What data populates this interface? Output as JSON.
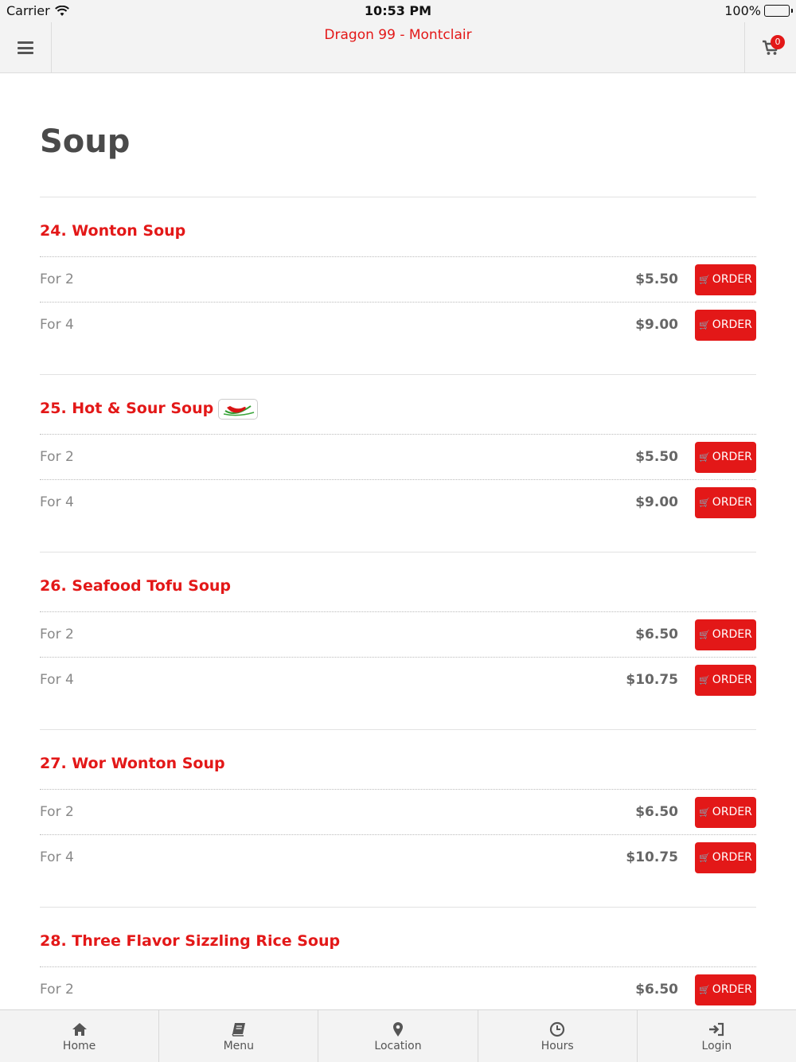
{
  "status_bar": {
    "carrier": "Carrier",
    "time": "10:53 PM",
    "battery": "100%"
  },
  "navbar": {
    "title": "Dragon 99 - Montclair",
    "cart_count": "0"
  },
  "page": {
    "title": "Soup"
  },
  "order_label": "ORDER",
  "items": [
    {
      "title": "24. Wonton Soup",
      "spicy": false,
      "options": [
        {
          "label": "For 2",
          "price": "$5.50"
        },
        {
          "label": "For 4",
          "price": "$9.00"
        }
      ]
    },
    {
      "title": "25. Hot & Sour Soup",
      "spicy": true,
      "options": [
        {
          "label": "For 2",
          "price": "$5.50"
        },
        {
          "label": "For 4",
          "price": "$9.00"
        }
      ]
    },
    {
      "title": "26. Seafood Tofu Soup",
      "spicy": false,
      "options": [
        {
          "label": "For 2",
          "price": "$6.50"
        },
        {
          "label": "For 4",
          "price": "$10.75"
        }
      ]
    },
    {
      "title": "27. Wor Wonton Soup",
      "spicy": false,
      "options": [
        {
          "label": "For 2",
          "price": "$6.50"
        },
        {
          "label": "For 4",
          "price": "$10.75"
        }
      ]
    },
    {
      "title": "28. Three Flavor Sizzling Rice Soup",
      "spicy": false,
      "options": [
        {
          "label": "For 2",
          "price": "$6.50"
        }
      ]
    }
  ],
  "tabs": [
    {
      "label": "Home",
      "icon": "home-icon"
    },
    {
      "label": "Menu",
      "icon": "book-icon"
    },
    {
      "label": "Location",
      "icon": "map-pin-icon"
    },
    {
      "label": "Hours",
      "icon": "clock-icon"
    },
    {
      "label": "Login",
      "icon": "sign-in-icon"
    }
  ],
  "colors": {
    "accent": "#e31818",
    "bar_bg": "#f3f3f3"
  }
}
